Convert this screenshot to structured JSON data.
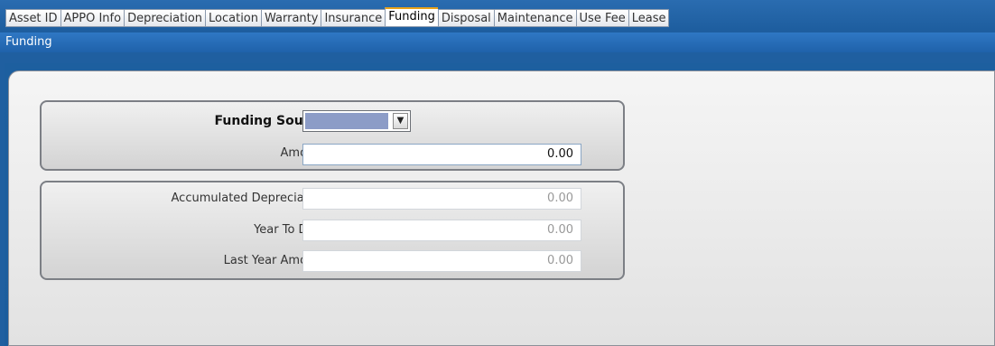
{
  "tabs": [
    {
      "label": "Asset ID"
    },
    {
      "label": "APPO Info"
    },
    {
      "label": "Depreciation"
    },
    {
      "label": "Location"
    },
    {
      "label": "Warranty"
    },
    {
      "label": "Insurance"
    },
    {
      "label": "Funding"
    },
    {
      "label": "Disposal"
    },
    {
      "label": "Maintenance"
    },
    {
      "label": "Use Fee"
    },
    {
      "label": "Lease"
    }
  ],
  "active_tab": "Funding",
  "header": {
    "title": "Funding"
  },
  "funding_group": {
    "source_label": "Funding Source:",
    "source_value": "",
    "amount_label": "Amount:",
    "amount_value": "0.00"
  },
  "depreciation_group": {
    "accum_label": "Accumulated Depreciation:",
    "accum_value": "0.00",
    "ytd_label": "Year To Date:",
    "ytd_value": "0.00",
    "last_year_label": "Last Year Amount:",
    "last_year_value": "0.00"
  },
  "colors": {
    "accent_tab_border": "#e9a21a",
    "window_blue": "#1f5fa0",
    "select_swatch": "#8c9cc7"
  },
  "icons": {
    "dropdown": "chevron-down-icon"
  }
}
